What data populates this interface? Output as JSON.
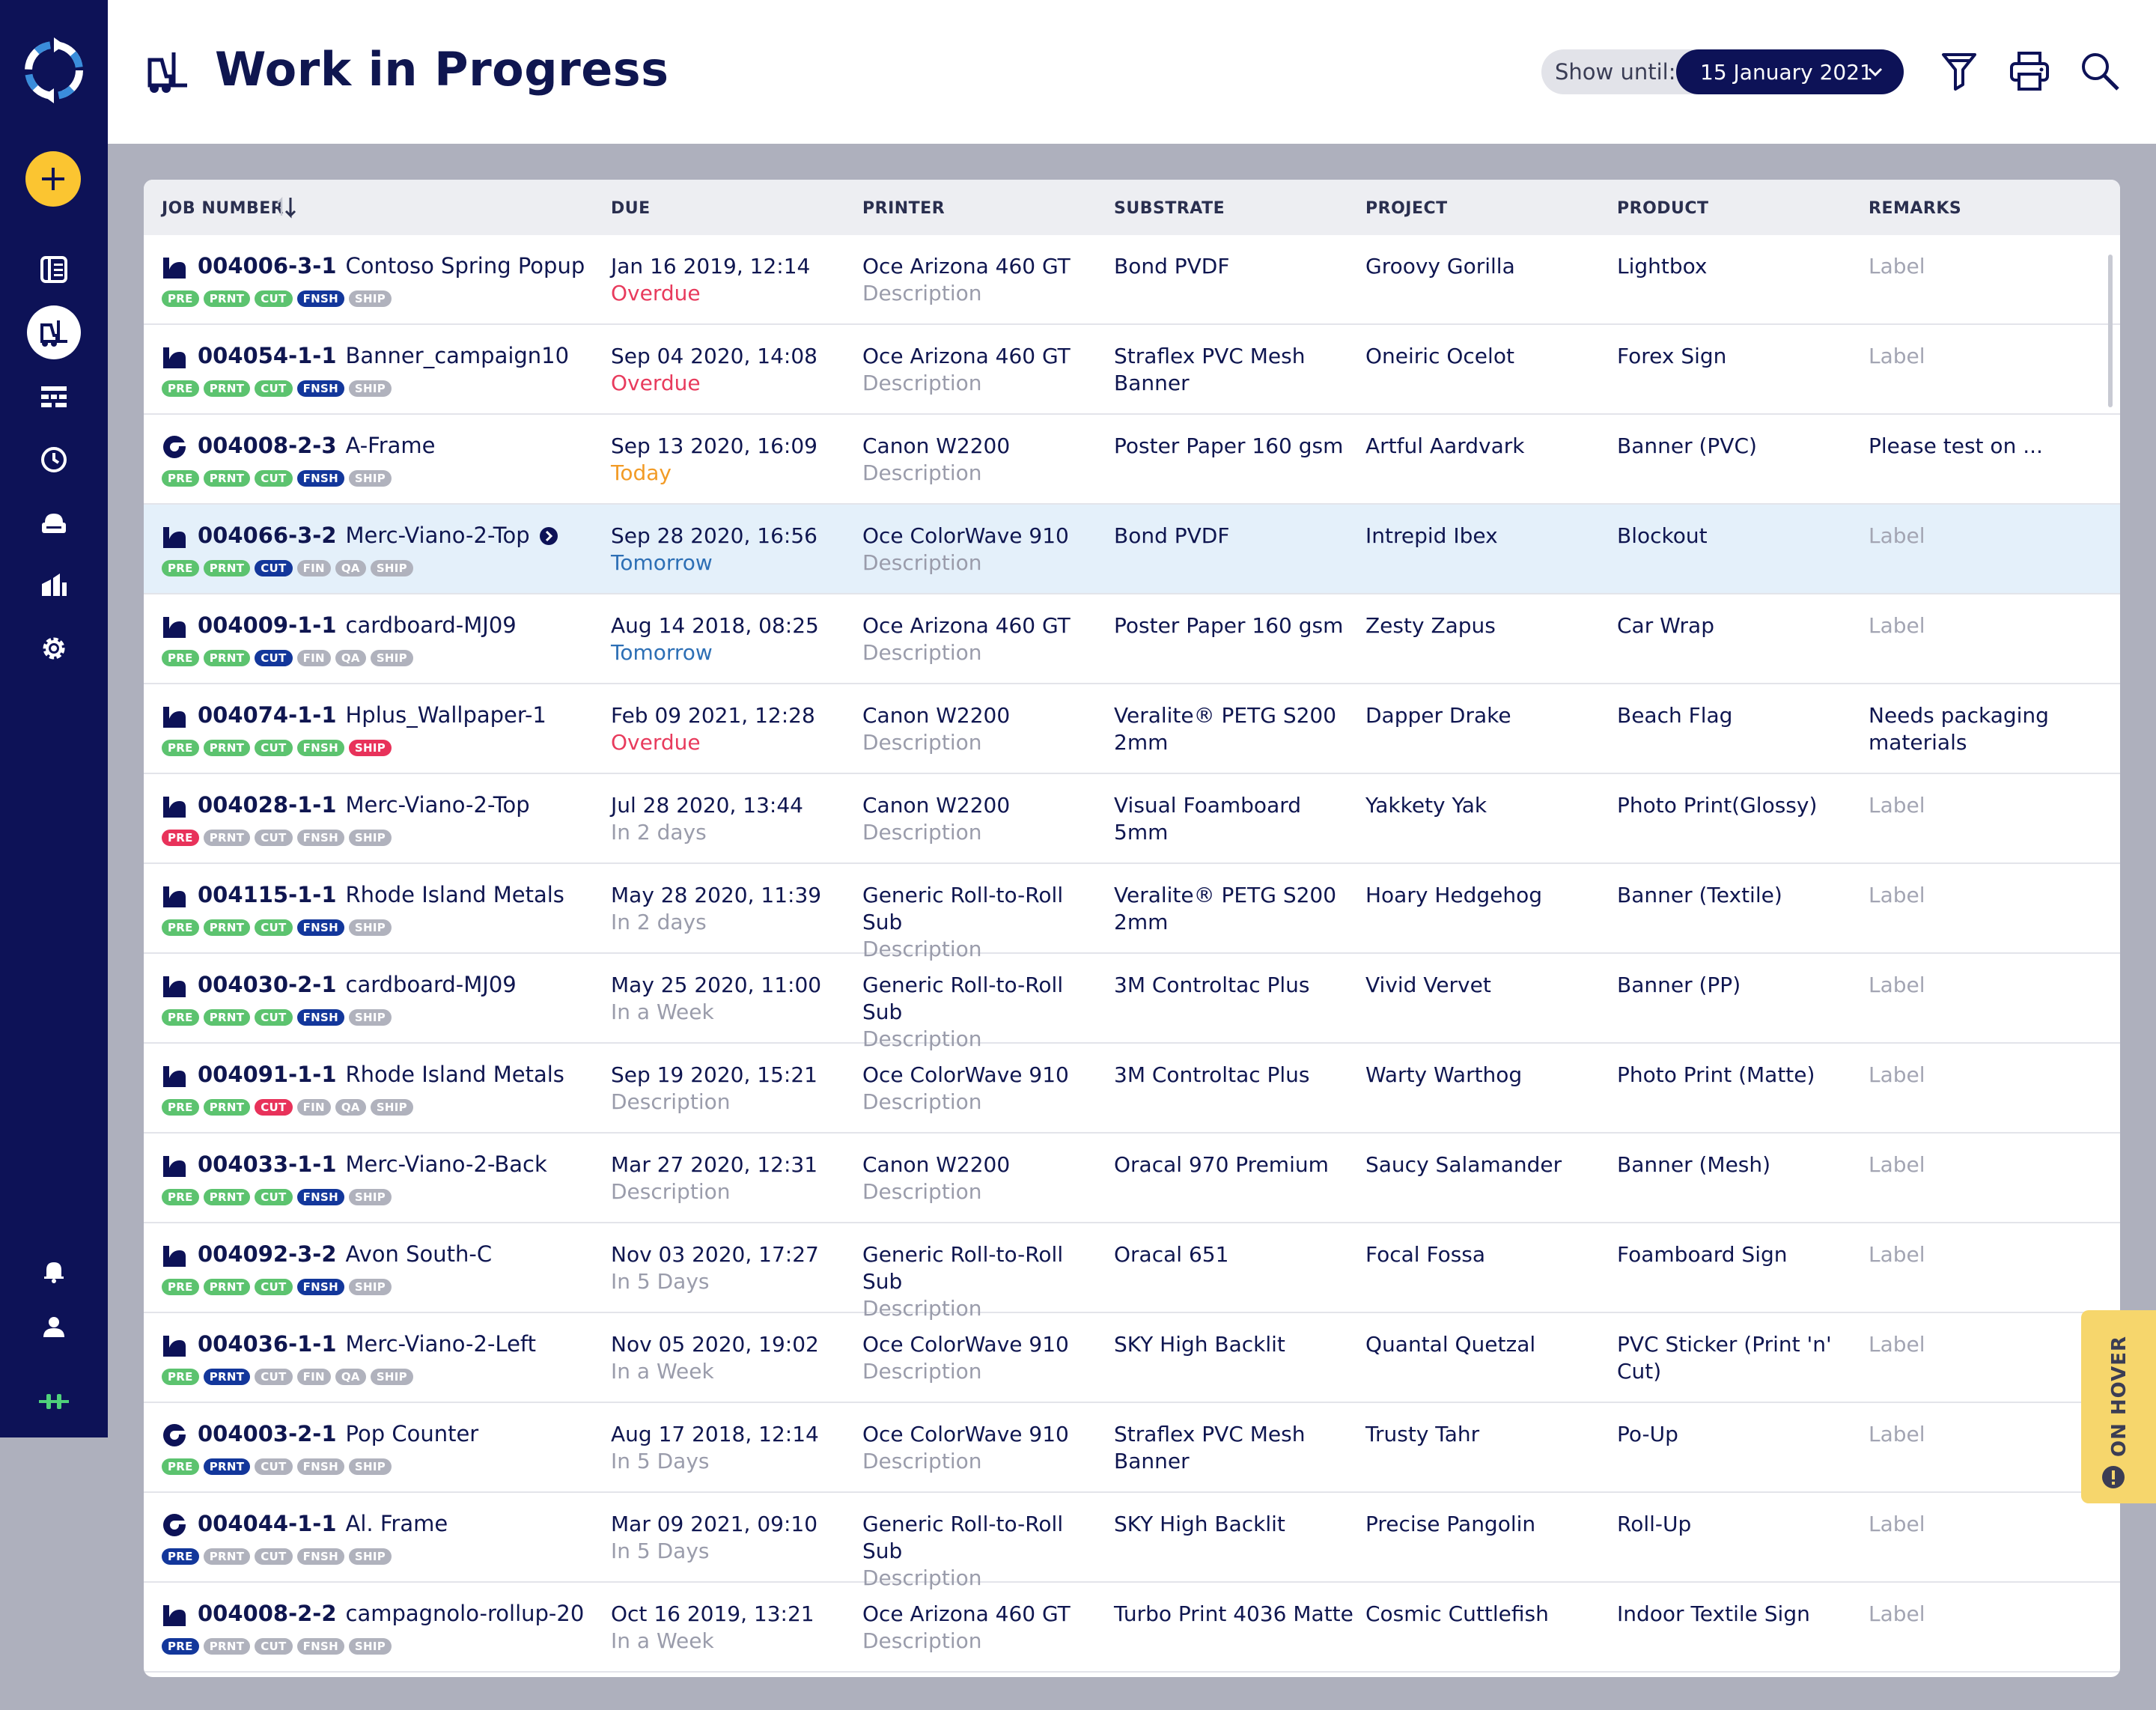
{
  "app": {
    "title": "Work in Progress",
    "show_until_label": "Show until:",
    "show_until_value": "15 January 2021",
    "hover_tab": "ON HOVER"
  },
  "sidebar": {
    "items": [
      {
        "name": "sidebar-item-jobs",
        "icon": "book-icon"
      },
      {
        "name": "sidebar-item-work-in-progress",
        "icon": "forklift-icon",
        "active": true
      },
      {
        "name": "sidebar-item-schedule",
        "icon": "grid-icon"
      },
      {
        "name": "sidebar-item-history",
        "icon": "clock-icon"
      },
      {
        "name": "sidebar-item-printers",
        "icon": "printer-icon"
      },
      {
        "name": "sidebar-item-reports",
        "icon": "chart-icon"
      },
      {
        "name": "sidebar-item-settings",
        "icon": "gear-icon"
      }
    ]
  },
  "table": {
    "columns": [
      "JOB NUMBER",
      "DUE",
      "PRINTER",
      "SUBSTRATE",
      "PROJECT",
      "PRODUCT",
      "REMARKS"
    ],
    "rows": [
      {
        "type": "sheet",
        "job": "004006-3-1",
        "name": "Contoso Spring Popup",
        "badges": [
          [
            "PRE",
            "g"
          ],
          [
            "PRNT",
            "g"
          ],
          [
            "CUT",
            "g"
          ],
          [
            "FNSH",
            "n"
          ],
          [
            "SHIP",
            "x"
          ]
        ],
        "due": "Jan 16 2019, 12:14",
        "due_sub": "Overdue",
        "due_class": "overdue",
        "printer": "Oce Arizona 460 GT",
        "printer_sub": "Description",
        "substrate": "Bond PVDF",
        "project": "Groovy Gorilla",
        "product": "Lightbox",
        "remarks": "Label",
        "remarks_grey": true
      },
      {
        "type": "sheet",
        "job": "004054-1-1",
        "name": "Banner_campaign10",
        "badges": [
          [
            "PRE",
            "g"
          ],
          [
            "PRNT",
            "g"
          ],
          [
            "CUT",
            "g"
          ],
          [
            "FNSH",
            "n"
          ],
          [
            "SHIP",
            "x"
          ]
        ],
        "due": "Sep 04 2020, 14:08",
        "due_sub": "Overdue",
        "due_class": "overdue",
        "printer": "Oce Arizona 460 GT",
        "printer_sub": "Description",
        "substrate": "Straflex PVC Mesh Banner",
        "project": "Oneiric Ocelot",
        "product": "Forex Sign",
        "remarks": "Label",
        "remarks_grey": true
      },
      {
        "type": "roll",
        "job": "004008-2-3",
        "name": "A-Frame",
        "badges": [
          [
            "PRE",
            "g"
          ],
          [
            "PRNT",
            "g"
          ],
          [
            "CUT",
            "g"
          ],
          [
            "FNSH",
            "n"
          ],
          [
            "SHIP",
            "x"
          ]
        ],
        "due": "Sep 13 2020, 16:09",
        "due_sub": "Today",
        "due_class": "today",
        "printer": "Canon W2200",
        "printer_sub": "Description",
        "substrate": "Poster Paper 160 gsm",
        "project": "Artful Aardvark",
        "product": "Banner (PVC)",
        "remarks": "Please test on ...",
        "remarks_grey": false
      },
      {
        "type": "sheet",
        "job": "004066-3-2",
        "name": "Merc-Viano-2-Top",
        "arrow": true,
        "highlight": true,
        "badges": [
          [
            "PRE",
            "g"
          ],
          [
            "PRNT",
            "g"
          ],
          [
            "CUT",
            "n"
          ],
          [
            "FIN",
            "x"
          ],
          [
            "QA",
            "x"
          ],
          [
            "SHIP",
            "x"
          ]
        ],
        "due": "Sep 28 2020, 16:56",
        "due_sub": "Tomorrow",
        "due_class": "tomorrow",
        "printer": "Oce ColorWave 910",
        "printer_sub": "Description",
        "substrate": "Bond PVDF",
        "project": "Intrepid Ibex",
        "product": "Blockout",
        "remarks": "Label",
        "remarks_grey": true
      },
      {
        "type": "sheet",
        "job": "004009-1-1",
        "name": "cardboard-MJ09",
        "badges": [
          [
            "PRE",
            "g"
          ],
          [
            "PRNT",
            "g"
          ],
          [
            "CUT",
            "n"
          ],
          [
            "FIN",
            "x"
          ],
          [
            "QA",
            "x"
          ],
          [
            "SHIP",
            "x"
          ]
        ],
        "due": "Aug 14 2018, 08:25",
        "due_sub": "Tomorrow",
        "due_class": "tomorrow",
        "printer": "Oce Arizona 460 GT",
        "printer_sub": "Description",
        "substrate": "Poster Paper 160 gsm",
        "project": "Zesty Zapus",
        "product": "Car Wrap",
        "remarks": "Label",
        "remarks_grey": true
      },
      {
        "type": "sheet",
        "job": "004074-1-1",
        "name": "Hplus_Wallpaper-1",
        "badges": [
          [
            "PRE",
            "g"
          ],
          [
            "PRNT",
            "g"
          ],
          [
            "CUT",
            "g"
          ],
          [
            "FNSH",
            "g"
          ],
          [
            "SHIP",
            "r"
          ]
        ],
        "due": "Feb 09 2021, 12:28",
        "due_sub": "Overdue",
        "due_class": "overdue",
        "printer": "Canon W2200",
        "printer_sub": "Description",
        "substrate": "Veralite® PETG S200 2mm",
        "project": "Dapper Drake",
        "product": "Beach Flag",
        "remarks": "Needs packaging materials",
        "remarks_grey": false
      },
      {
        "type": "sheet",
        "job": "004028-1-1",
        "name": "Merc-Viano-2-Top",
        "badges": [
          [
            "PRE",
            "r"
          ],
          [
            "PRNT",
            "x"
          ],
          [
            "CUT",
            "x"
          ],
          [
            "FNSH",
            "x"
          ],
          [
            "SHIP",
            "x"
          ]
        ],
        "due": "Jul 28 2020, 13:44",
        "due_sub": "In 2 days",
        "due_class": "",
        "printer": "Canon W2200",
        "printer_sub": "Description",
        "substrate": "Visual Foamboard 5mm",
        "project": "Yakkety Yak",
        "product": "Photo Print(Glossy)",
        "remarks": "Label",
        "remarks_grey": true
      },
      {
        "type": "sheet",
        "job": "004115-1-1",
        "name": "Rhode Island Metals",
        "badges": [
          [
            "PRE",
            "g"
          ],
          [
            "PRNT",
            "g"
          ],
          [
            "CUT",
            "g"
          ],
          [
            "FNSH",
            "n"
          ],
          [
            "SHIP",
            "x"
          ]
        ],
        "due": "May 28 2020, 11:39",
        "due_sub": "In 2 days",
        "due_class": "",
        "printer": "Generic Roll-to-Roll Sub",
        "printer_sub": "Description",
        "substrate": "Veralite® PETG S200 2mm",
        "project": "Hoary Hedgehog",
        "product": "Banner (Textile)",
        "remarks": "Label",
        "remarks_grey": true
      },
      {
        "type": "sheet",
        "job": "004030-2-1",
        "name": "cardboard-MJ09",
        "badges": [
          [
            "PRE",
            "g"
          ],
          [
            "PRNT",
            "g"
          ],
          [
            "CUT",
            "g"
          ],
          [
            "FNSH",
            "n"
          ],
          [
            "SHIP",
            "x"
          ]
        ],
        "due": "May 25 2020, 11:00",
        "due_sub": "In a Week",
        "due_class": "",
        "printer": "Generic Roll-to-Roll Sub",
        "printer_sub": "Description",
        "substrate": "3M Controltac Plus",
        "project": "Vivid Vervet",
        "product": "Banner (PP)",
        "remarks": "Label",
        "remarks_grey": true
      },
      {
        "type": "sheet",
        "job": "004091-1-1",
        "name": "Rhode Island Metals",
        "badges": [
          [
            "PRE",
            "g"
          ],
          [
            "PRNT",
            "g"
          ],
          [
            "CUT",
            "r"
          ],
          [
            "FIN",
            "x"
          ],
          [
            "QA",
            "x"
          ],
          [
            "SHIP",
            "x"
          ]
        ],
        "due": "Sep 19 2020, 15:21",
        "due_sub": "Description",
        "due_class": "",
        "printer": "Oce ColorWave 910",
        "printer_sub": "Description",
        "substrate": "3M Controltac Plus",
        "project": "Warty Warthog",
        "product": "Photo Print (Matte)",
        "remarks": "Label",
        "remarks_grey": true
      },
      {
        "type": "sheet",
        "job": "004033-1-1",
        "name": "Merc-Viano-2-Back",
        "badges": [
          [
            "PRE",
            "g"
          ],
          [
            "PRNT",
            "g"
          ],
          [
            "CUT",
            "g"
          ],
          [
            "FNSH",
            "n"
          ],
          [
            "SHIP",
            "x"
          ]
        ],
        "due": "Mar 27 2020, 12:31",
        "due_sub": "Description",
        "due_class": "",
        "printer": "Canon W2200",
        "printer_sub": "Description",
        "substrate": "Oracal 970 Premium",
        "project": "Saucy Salamander",
        "product": "Banner (Mesh)",
        "remarks": "Label",
        "remarks_grey": true
      },
      {
        "type": "sheet",
        "job": "004092-3-2",
        "name": "Avon South-C",
        "badges": [
          [
            "PRE",
            "g"
          ],
          [
            "PRNT",
            "g"
          ],
          [
            "CUT",
            "g"
          ],
          [
            "FNSH",
            "n"
          ],
          [
            "SHIP",
            "x"
          ]
        ],
        "due": "Nov 03 2020, 17:27",
        "due_sub": "In 5 Days",
        "due_class": "",
        "printer": "Generic Roll-to-Roll Sub",
        "printer_sub": "Description",
        "substrate": "Oracal 651",
        "project": "Focal Fossa",
        "product": "Foamboard Sign",
        "remarks": "Label",
        "remarks_grey": true
      },
      {
        "type": "sheet",
        "job": "004036-1-1",
        "name": "Merc-Viano-2-Left",
        "badges": [
          [
            "PRE",
            "g"
          ],
          [
            "PRNT",
            "n"
          ],
          [
            "CUT",
            "x"
          ],
          [
            "FIN",
            "x"
          ],
          [
            "QA",
            "x"
          ],
          [
            "SHIP",
            "x"
          ]
        ],
        "due": "Nov 05 2020, 19:02",
        "due_sub": "In a Week",
        "due_class": "",
        "printer": "Oce ColorWave 910",
        "printer_sub": "Description",
        "substrate": "SKY High Backlit",
        "project": "Quantal Quetzal",
        "product": "PVC Sticker (Print 'n' Cut)",
        "remarks": "Label",
        "remarks_grey": true
      },
      {
        "type": "roll",
        "job": "004003-2-1",
        "name": "Pop Counter",
        "badges": [
          [
            "PRE",
            "g"
          ],
          [
            "PRNT",
            "n"
          ],
          [
            "CUT",
            "x"
          ],
          [
            "FNSH",
            "x"
          ],
          [
            "SHIP",
            "x"
          ]
        ],
        "due": "Aug 17 2018, 12:14",
        "due_sub": "In 5 Days",
        "due_class": "",
        "printer": "Oce ColorWave 910",
        "printer_sub": "Description",
        "substrate": "Straflex PVC Mesh Banner",
        "project": "Trusty Tahr",
        "product": "Po-Up",
        "remarks": "Label",
        "remarks_grey": true
      },
      {
        "type": "roll",
        "job": "004044-1-1",
        "name": "Al. Frame",
        "badges": [
          [
            "PRE",
            "n"
          ],
          [
            "PRNT",
            "x"
          ],
          [
            "CUT",
            "x"
          ],
          [
            "FNSH",
            "x"
          ],
          [
            "SHIP",
            "x"
          ]
        ],
        "due": "Mar 09 2021, 09:10",
        "due_sub": "In 5 Days",
        "due_class": "",
        "printer": "Generic Roll-to-Roll Sub",
        "printer_sub": "Description",
        "substrate": "SKY High Backlit",
        "project": "Precise Pangolin",
        "product": "Roll-Up",
        "remarks": "Label",
        "remarks_grey": true
      },
      {
        "type": "sheet",
        "job": "004008-2-2",
        "name": "campagnolo-rollup-20",
        "badges": [
          [
            "PRE",
            "n"
          ],
          [
            "PRNT",
            "x"
          ],
          [
            "CUT",
            "x"
          ],
          [
            "FNSH",
            "x"
          ],
          [
            "SHIP",
            "x"
          ]
        ],
        "due": "Oct 16 2019, 13:21",
        "due_sub": "In a Week",
        "due_class": "",
        "printer": "Oce Arizona 460 GT",
        "printer_sub": "Description",
        "substrate": "Turbo Print 4036 Matte",
        "project": "Cosmic Cuttlefish",
        "product": "Indoor Textile Sign",
        "remarks": "Label",
        "remarks_grey": true
      }
    ]
  },
  "colors": {
    "navy": "#0d1257",
    "accent_yellow": "#fbc531",
    "status_green": "#5cc36f",
    "status_navy": "#13379b",
    "status_grey": "#b0b2bd",
    "status_red": "#e8325a",
    "overdue": "#e83b5d",
    "today": "#f29b26",
    "tomorrow": "#2d6fb5"
  }
}
